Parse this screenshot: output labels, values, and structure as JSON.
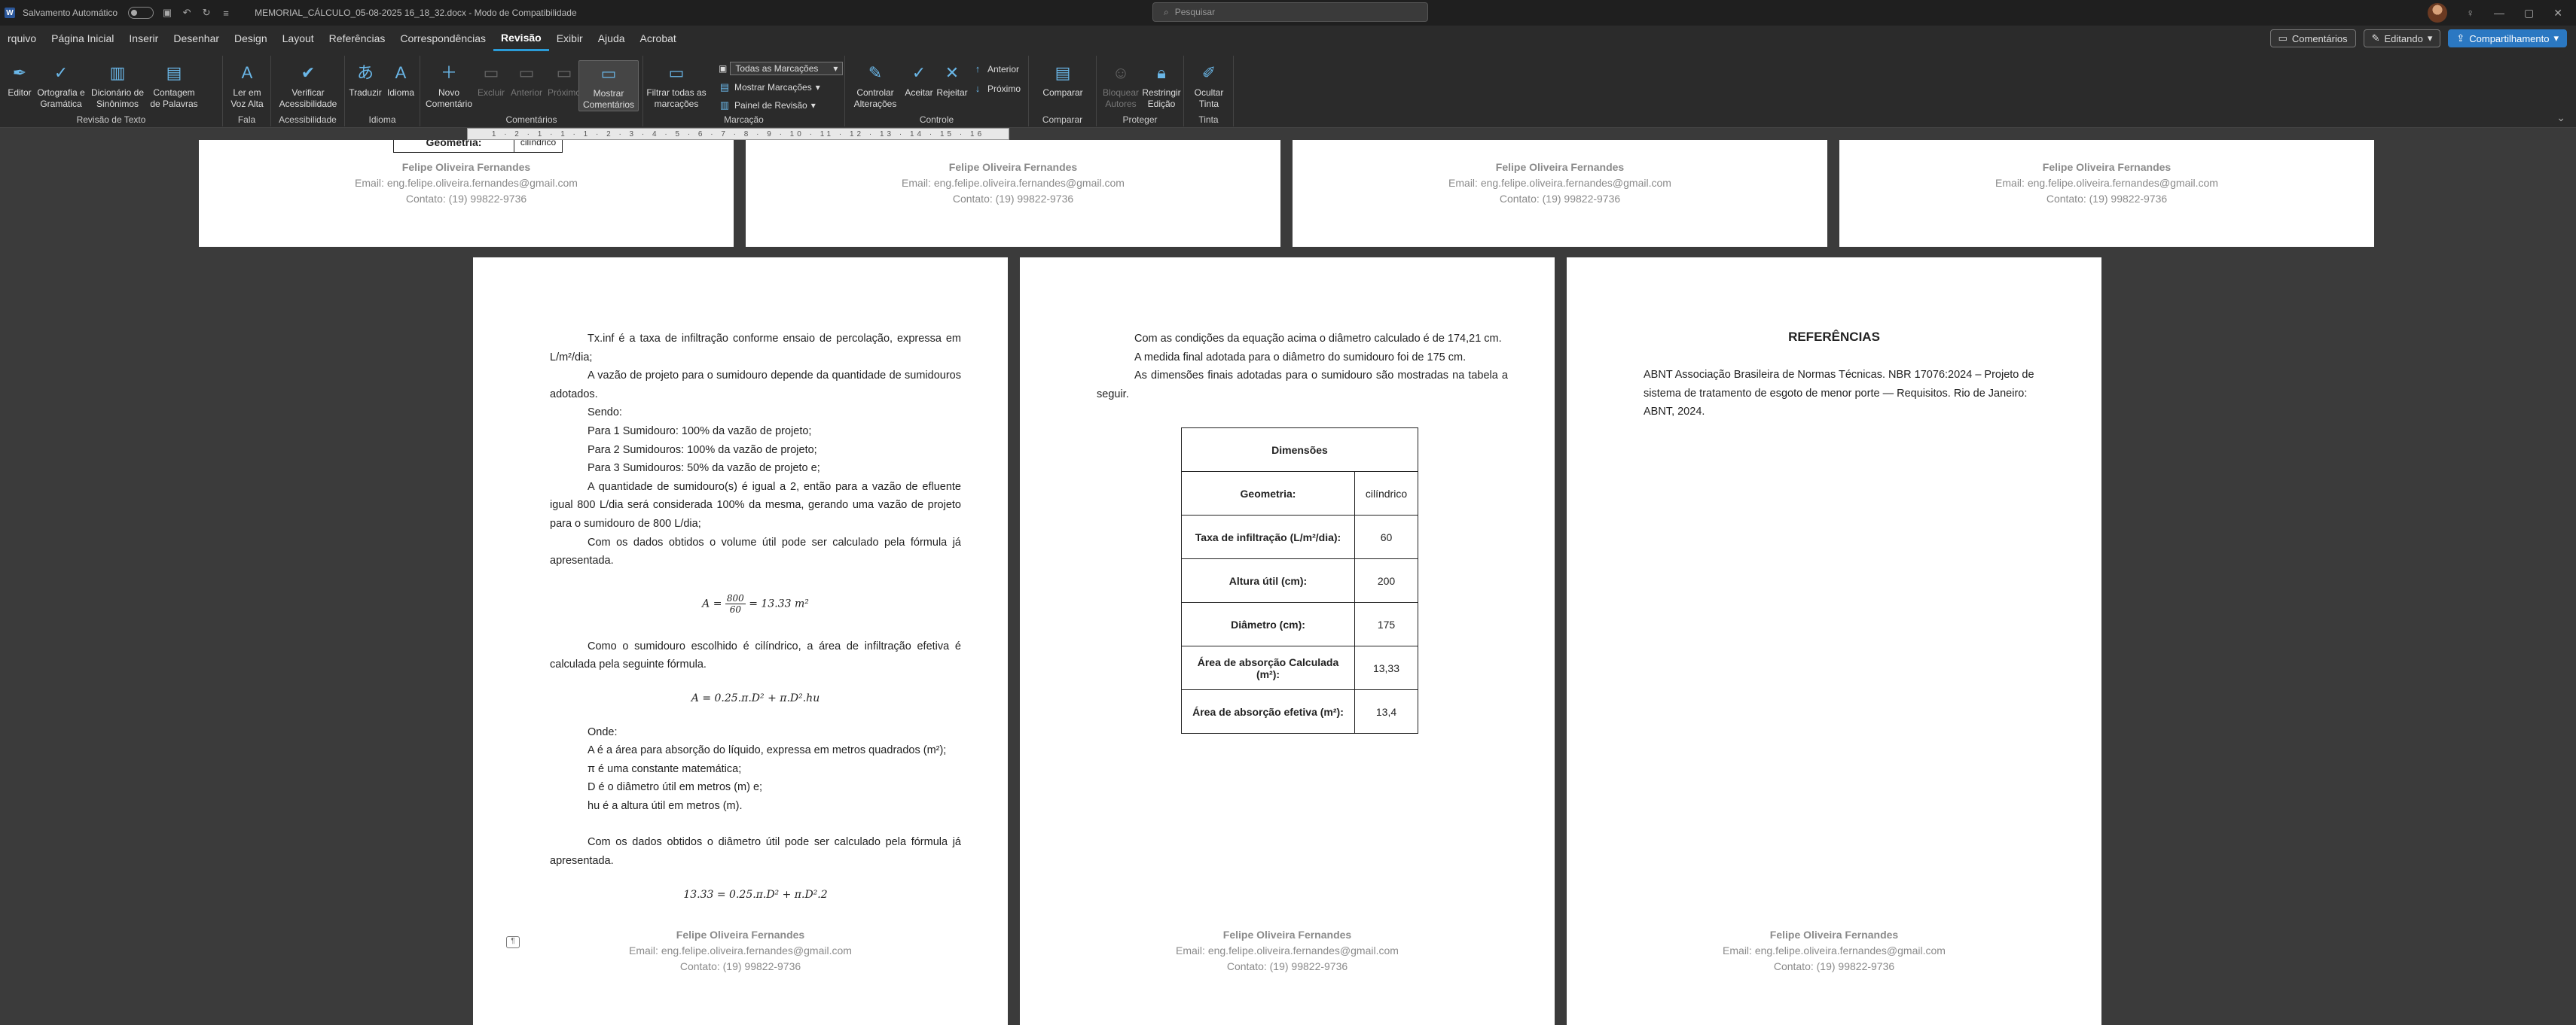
{
  "titlebar": {
    "autosave_label": "Salvamento Automático",
    "doc_title": "MEMORIAL_CÁLCULO_05-08-2025 16_18_32.docx  -  Modo de Compatibilidade",
    "search_placeholder": "Pesquisar"
  },
  "tabs": [
    "rquivo",
    "Página Inicial",
    "Inserir",
    "Desenhar",
    "Design",
    "Layout",
    "Referências",
    "Correspondências",
    "Revisão",
    "Exibir",
    "Ajuda",
    "Acrobat"
  ],
  "active_tab": "Revisão",
  "tab_actions": {
    "comments": "Comentários",
    "editing": "Editando",
    "share": "Compartilhamento"
  },
  "ribbon": {
    "groups": {
      "proofing": "Revisão de Texto",
      "speech": "Fala",
      "accessibility": "Acessibilidade",
      "language": "Idioma",
      "comments": "Comentários",
      "tracking": "Marcação",
      "changes": "Controle",
      "compare": "Comparar",
      "protect": "Proteger",
      "ink": "Tinta"
    },
    "buttons": {
      "editor": "Editor",
      "spelling": "Ortografia e\nGramática",
      "thesaurus": "Dicionário de\nSinônimos",
      "wordcount": "Contagem\nde Palavras",
      "read_aloud": "Ler em\nVoz Alta",
      "check_access": "Verificar\nAcessibilidade",
      "translate": "Traduzir",
      "language": "Idioma",
      "new_comment": "Novo\nComentário",
      "delete": "Excluir",
      "previous": "Anterior",
      "next": "Próximo",
      "show_comments": "Mostrar\nComentários",
      "filter_all": "Filtrar todas as\nmarcações",
      "track_changes": "Controlar\nAlterações",
      "accept": "Aceitar",
      "reject": "Rejeitar",
      "prev_change": "Anterior",
      "next_change": "Próximo",
      "compare": "Comparar",
      "block_authors": "Bloquear\nAutores",
      "restrict_edit": "Restringir\nEdição",
      "hide_ink": "Ocultar\nTinta"
    },
    "markup_select": "Todas as Marcações",
    "show_markup": "Mostrar Marcações",
    "review_pane": "Painel de Revisão"
  },
  "ruler_text": "1 · 2 · 1 · 1 · 1 · 2 · 3 · 4 · 5 · 6 · 7 · 8 · 9 · 10 · 11 · 12 · 13 · 14 · 15 · 16",
  "footer": {
    "name": "Felipe Oliveira Fernandes",
    "email": "Email: eng.felipe.oliveira.fernandes@gmail.com",
    "contact": "Contato: (19) 99822-9736"
  },
  "top_page_fragment": {
    "label": "Geometria:",
    "value": "cilíndrico"
  },
  "page1": {
    "p1": "Tx.inf é a taxa de infiltração conforme ensaio de percolação, expressa em L/m²/dia;",
    "p2": "A vazão de projeto para o sumidouro depende da quantidade de sumidouros adotados.",
    "p3": "Sendo:",
    "p4": "Para 1 Sumidouro: 100% da vazão de projeto;",
    "p5": "Para 2 Sumidouros: 100% da vazão de projeto;",
    "p6": "Para 3 Sumidouros: 50% da vazão de projeto e;",
    "p7": "A quantidade de sumidouro(s) é igual a 2, então para a vazão de efluente igual 800 L/dia será considerada 100% da mesma, gerando uma vazão de projeto para o sumidouro de 800 L/dia;",
    "p8": "Com os dados obtidos o volume útil pode ser calculado pela fórmula já apresentada.",
    "eq1_lhs": "A =",
    "eq1_num": "800",
    "eq1_den": "60",
    "eq1_rhs": "= 13.33 m²",
    "p9": "Como o sumidouro escolhido é cilíndrico, a área de infiltração efetiva é calculada pela seguinte fórmula.",
    "eq2": "A = 0.25.π.D² + π.D².hu",
    "p10": "Onde:",
    "p11": "A é a área para absorção do líquido, expressa em metros quadrados (m²);",
    "p12": "π é uma constante matemática;",
    "p13": "D é o diâmetro útil em metros (m) e;",
    "p14": "hu é a altura útil em metros (m).",
    "p15": "Com os dados obtidos o diâmetro útil pode ser calculado pela fórmula já apresentada.",
    "eq3": "13.33 = 0.25.π.D² + π.D².2"
  },
  "page2": {
    "p1": "Com as condições da equação acima o diâmetro calculado é de 174,21 cm.",
    "p2": "A medida final adotada para o diâmetro do sumidouro foi de 175 cm.",
    "p3": "As dimensões finais adotadas para o sumidouro são mostradas na tabela a seguir.",
    "table_title": "Dimensões",
    "rows": [
      {
        "label": "Geometria:",
        "value": "cilíndrico"
      },
      {
        "label": "Taxa de infiltração (L/m²/dia):",
        "value": "60"
      },
      {
        "label": "Altura útil (cm):",
        "value": "200"
      },
      {
        "label": "Diâmetro (cm):",
        "value": "175"
      },
      {
        "label": "Área de absorção Calculada (m²):",
        "value": "13,33"
      },
      {
        "label": "Área de absorção efetiva (m²):",
        "value": "13,4"
      }
    ]
  },
  "page3": {
    "title": "REFERÊNCIAS",
    "ref1": "ABNT Associação Brasileira de Normas Técnicas. NBR 17076:2024 – Projeto de sistema de tratamento de esgoto de menor porte — Requisitos. Rio de Janeiro: ABNT, 2024."
  }
}
